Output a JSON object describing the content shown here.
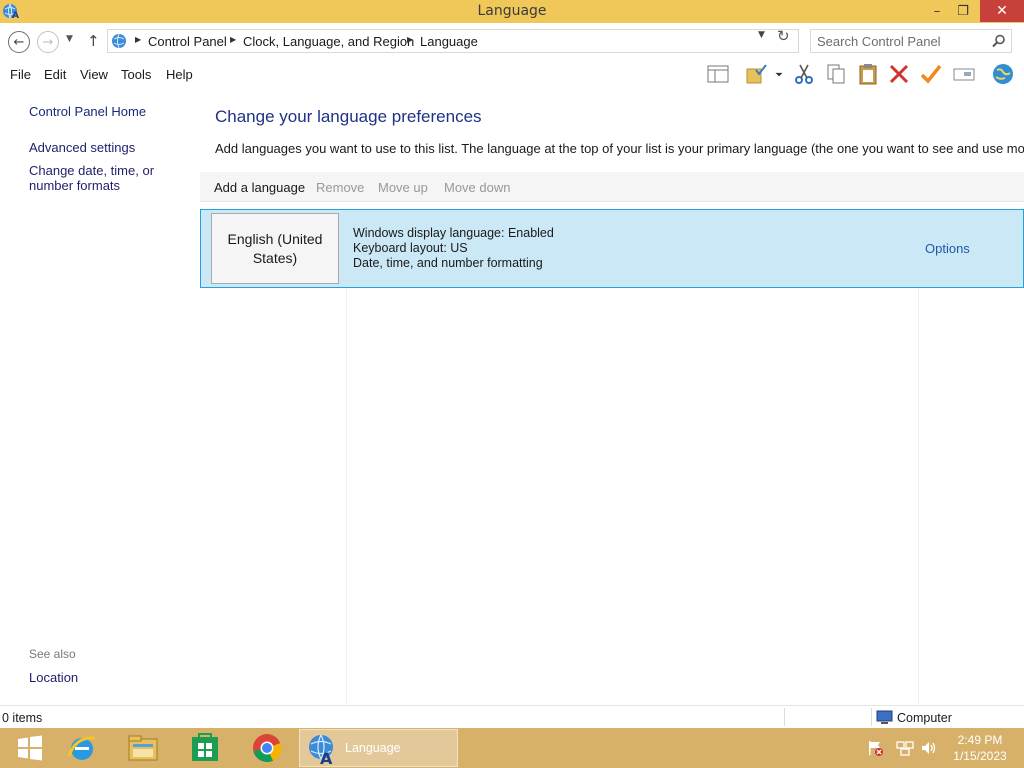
{
  "window": {
    "title": "Language",
    "icon": "language-globe-icon",
    "controls": {
      "minimize": "–",
      "maximize": "❐",
      "close": "✕"
    }
  },
  "address": {
    "breadcrumbs": [
      "Control Panel",
      "Clock, Language, and Region",
      "Language"
    ],
    "search_placeholder": "Search Control Panel"
  },
  "menu": {
    "items": [
      "File",
      "Edit",
      "View",
      "Tools",
      "Help"
    ]
  },
  "toolbar": {
    "icons": [
      "preview-pane-icon",
      "folder-check-icon",
      "dropdown-icon",
      "cut-icon",
      "copy-icon",
      "paste-icon",
      "delete-icon",
      "checkmark-icon",
      "rename-icon",
      "globe-icon"
    ]
  },
  "left_pane": {
    "home": "Control Panel Home",
    "links": [
      "Advanced settings",
      "Change date, time, or number formats"
    ],
    "see_also": "See also",
    "see_also_links": [
      "Location"
    ]
  },
  "main": {
    "heading": "Change your language preferences",
    "description": "Add languages you want to use to this list. The language at the top of your list is your primary language (the one you want to see and use most often).",
    "actions": {
      "add": "Add a language",
      "remove": "Remove",
      "move_up": "Move up",
      "move_down": "Move down"
    },
    "languages": [
      {
        "name": "English (United States)",
        "details": [
          "Windows display language: Enabled",
          "Keyboard layout: US",
          "Date, time, and number formatting"
        ],
        "options": "Options"
      }
    ]
  },
  "status": {
    "items": "0 items",
    "location": "Computer"
  },
  "taskbar": {
    "active_window": "Language",
    "time": "2:49 PM",
    "date": "1/15/2023",
    "colors": {
      "bar": "#d7b06a",
      "title": "#f0c85a"
    }
  }
}
